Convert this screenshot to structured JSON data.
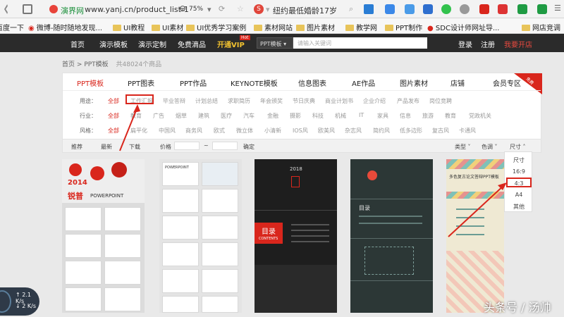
{
  "browser": {
    "site_name": "演界网",
    "url": "www.yanj.cn/product_list-1",
    "zoom": "75%",
    "search_text": "纽约最低婚龄17岁"
  },
  "bookmarks": [
    "百度一下",
    "微博-随时随地发现...",
    "UI教程",
    "UI素材",
    "UI优秀学习案例",
    "素材网站",
    "图片素材",
    "教学网",
    "PPT制作",
    "SDC设计师网址导...",
    "网店竞调"
  ],
  "nav": {
    "items": [
      "首页",
      "演示模板",
      "演示定制",
      "免费滴品"
    ],
    "vip_label": "开通VIP",
    "hot_badge": "Hot",
    "search_category": "PPT模板",
    "search_placeholder": "请输入关键词",
    "login": "登录",
    "register": "注册",
    "shop": "我要开店"
  },
  "breadcrumb": {
    "home": "首页",
    "sep": ">",
    "current": "PPT模板",
    "count": "共48024个商品"
  },
  "tabs": [
    "PPT模板",
    "PPT图表",
    "PPT作品",
    "KEYNOTE模板",
    "信息图表",
    "AE作品",
    "图片素材",
    "店铺",
    "会员专区"
  ],
  "vip_corner": "免费",
  "filters": {
    "usage_label": "用途：",
    "usage": [
      "全部",
      "工作汇报",
      "毕业答辩",
      "计划总结",
      "求职简历",
      "年会颁奖",
      "节日庆典",
      "商业计划书",
      "企业介绍",
      "产品发布",
      "岗位竞聘"
    ],
    "industry_label": "行业：",
    "industry": [
      "全部",
      "教育",
      "广告",
      "烟草",
      "建筑",
      "医疗",
      "汽车",
      "金融",
      "摄影",
      "科技",
      "机械",
      "IT",
      "家具",
      "信息",
      "旅游",
      "教育",
      "党政机关"
    ],
    "style_label": "风格：",
    "style": [
      "全部",
      "扁平化",
      "中国风",
      "商务风",
      "欧式",
      "微立体",
      "小清新",
      "IOS风",
      "欧美风",
      "杂志风",
      "简约风",
      "低多边形",
      "复古风",
      "卡通风"
    ]
  },
  "sortbar": {
    "recommend": "推荐",
    "newest": "最新",
    "downloads": "下载",
    "price": "价格",
    "dash": "~",
    "confirm": "确定",
    "type": "类型",
    "color": "色调",
    "size": "尺寸"
  },
  "size_dropdown": [
    "尺寸",
    "16:9",
    "4:3",
    "A4",
    "其他"
  ],
  "cards": [
    {
      "title": "锐普",
      "subtitle": "POWERPOINT",
      "year": "2014"
    },
    {
      "title": "POWERPOINT"
    },
    {
      "title": "目录",
      "subtitle": "CONTENTS",
      "year": "2018"
    },
    {
      "title": "目录"
    },
    {
      "title": "多色复古论文答辩PPT模板"
    }
  ],
  "speed": {
    "up": "2.1",
    "up_unit": "K/s",
    "down": "2",
    "down_unit": "K/s"
  },
  "watermark": "头条号 / 汤帅",
  "colors": {
    "accent_red": "#d9261c",
    "nav_bg": "#2b2b2b"
  }
}
